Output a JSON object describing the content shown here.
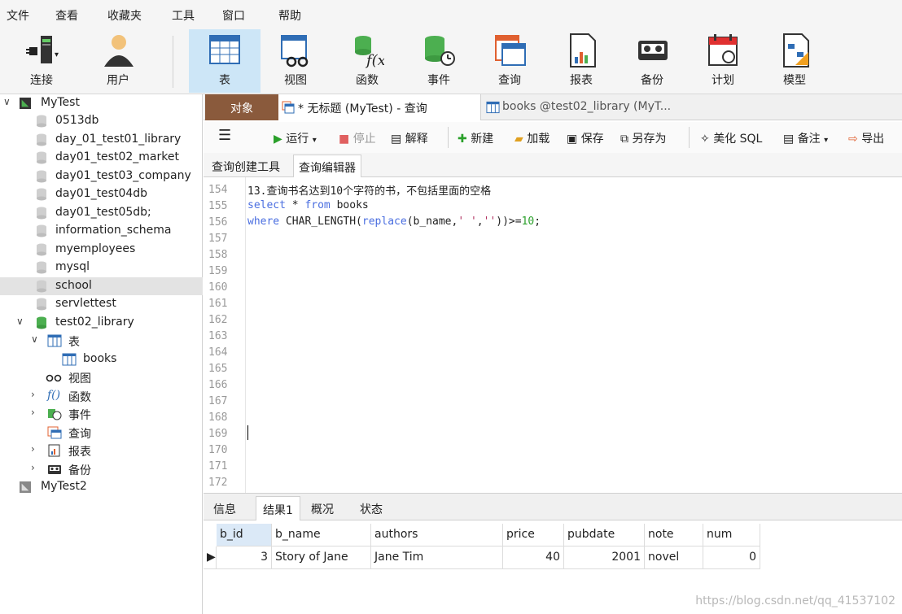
{
  "menu": [
    "文件",
    "查看",
    "收藏夹",
    "工具",
    "窗口",
    "帮助"
  ],
  "toolbar": {
    "items": [
      {
        "label": "连接",
        "icon": "connection-icon"
      },
      {
        "label": "用户",
        "icon": "user-icon"
      },
      {
        "label": "表",
        "icon": "table-icon"
      },
      {
        "label": "视图",
        "icon": "view-icon"
      },
      {
        "label": "函数",
        "icon": "function-icon"
      },
      {
        "label": "事件",
        "icon": "event-icon"
      },
      {
        "label": "查询",
        "icon": "query-icon"
      },
      {
        "label": "报表",
        "icon": "report-icon"
      },
      {
        "label": "备份",
        "icon": "backup-icon"
      },
      {
        "label": "计划",
        "icon": "schedule-icon"
      },
      {
        "label": "模型",
        "icon": "model-icon"
      }
    ],
    "active": "表"
  },
  "tree": {
    "connection": "MyTest",
    "databases": [
      "0513db",
      "day_01_test01_library",
      "day01_test02_market",
      "day01_test03_company",
      "day01_test04db",
      "day01_test05db;",
      "information_schema",
      "myemployees",
      "mysql",
      "school",
      "servlettest",
      "test02_library"
    ],
    "selected": "school",
    "tables_label": "表",
    "table_item": "books",
    "views_label": "视图",
    "functions_label": "函数",
    "events_label": "事件",
    "queries_label": "查询",
    "reports_label": "报表",
    "backups_label": "备份",
    "connection2": "MyTest2"
  },
  "tabs": {
    "objects": "对象",
    "query": "* 无标题 (MyTest) - 查询",
    "books": "books @test02_library (MyT..."
  },
  "query_toolbar": {
    "run": "运行",
    "stop": "停止",
    "explain": "解释",
    "new": "新建",
    "load": "加载",
    "save": "保存",
    "save_as": "另存为",
    "beautify": "美化 SQL",
    "comment": "备注",
    "export": "导出"
  },
  "subtabs": {
    "builder": "查询创建工具",
    "editor": "查询编辑器"
  },
  "editor": {
    "line_numbers": [
      "154",
      "155",
      "156",
      "157",
      "158",
      "159",
      "160",
      "161",
      "162",
      "163",
      "164",
      "165",
      "166",
      "167",
      "168",
      "169",
      "170",
      "171",
      "172"
    ],
    "line154": "13.查询书名达到10个字符的书，不包括里面的空格",
    "line155_kw1": "select",
    "line155_mid": " * ",
    "line155_kw2": "from",
    "line155_end": " books",
    "line156_kw1": "where",
    "line156_a": " CHAR_LENGTH(",
    "line156_kw2": "replace",
    "line156_b": "(b_name,",
    "line156_s1": "' '",
    "line156_c": ",",
    "line156_s2": "''",
    "line156_d": "))>=",
    "line156_n": "10",
    "line156_e": ";"
  },
  "result_tabs": {
    "info": "信息",
    "result": "结果1",
    "profile": "概况",
    "status": "状态"
  },
  "grid": {
    "columns": [
      "b_id",
      "b_name",
      "authors",
      "price",
      "pubdate",
      "note",
      "num"
    ],
    "row": [
      "3",
      "Story of Jane",
      "Jane Tim",
      "40",
      "2001",
      "novel",
      "0"
    ]
  },
  "watermark": "https://blog.csdn.net/qq_41537102"
}
